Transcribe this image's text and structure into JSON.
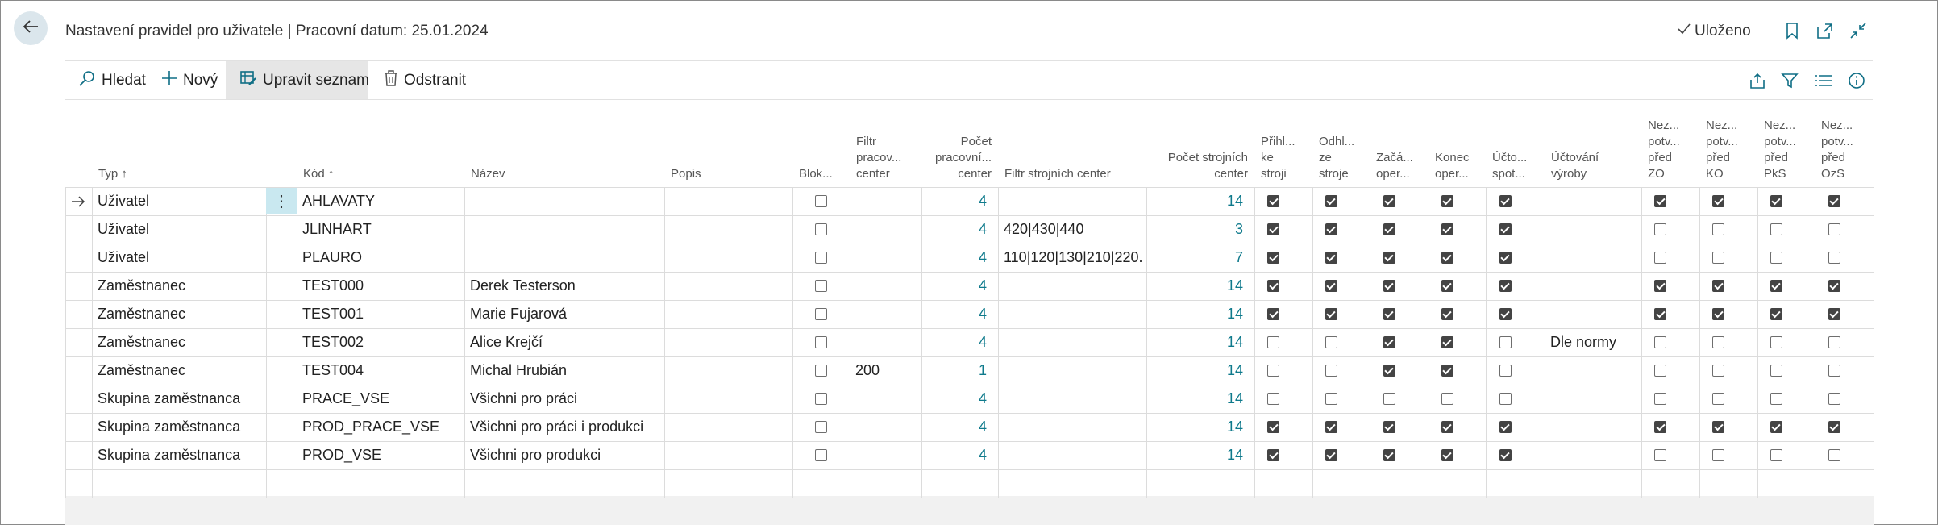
{
  "header": {
    "title": "Nastavení pravidel pro uživatele | Pracovní datum: 25.01.2024",
    "saved_label": "Uloženo"
  },
  "actions": {
    "search": "Hledat",
    "new": "Nový",
    "edit_list": "Upravit seznam",
    "delete": "Odstranit"
  },
  "columns": [
    {
      "key": "typ",
      "label": "Typ ↑"
    },
    {
      "key": "kod",
      "label": "Kód ↑"
    },
    {
      "key": "nazev",
      "label": "Název"
    },
    {
      "key": "popis",
      "label": "Popis"
    },
    {
      "key": "blok",
      "label": "Blok..."
    },
    {
      "key": "filtr_prac",
      "label": "Filtr\npracov...\ncenter"
    },
    {
      "key": "pocet_prac",
      "label": "Počet\npracovní...\ncenter"
    },
    {
      "key": "filtr_stroj",
      "label": "Filtr strojních center"
    },
    {
      "key": "pocet_stroj",
      "label": "Počet strojních\ncenter"
    },
    {
      "key": "prihl",
      "label": "Přihl...\nke\nstroji"
    },
    {
      "key": "odhl",
      "label": "Odhl...\nze\nstroje"
    },
    {
      "key": "zaca",
      "label": "Začá...\noper..."
    },
    {
      "key": "konec",
      "label": "Konec\noper..."
    },
    {
      "key": "ucto",
      "label": "Účto...\nspot..."
    },
    {
      "key": "uctovani",
      "label": "Účtování\nvýroby"
    },
    {
      "key": "nez_zo",
      "label": "Nez...\npotv...\npřed\nZO"
    },
    {
      "key": "nez_ko",
      "label": "Nez...\npotv...\npřed\nKO"
    },
    {
      "key": "nez_pks",
      "label": "Nez...\npotv...\npřed\nPkS"
    },
    {
      "key": "nez_ozs",
      "label": "Nez...\npotv...\npřed\nOzS"
    }
  ],
  "rows": [
    {
      "typ": "Uživatel",
      "kod": "AHLAVATY",
      "nazev": "",
      "popis": "",
      "blok": false,
      "filtr_prac": "",
      "pocet_prac": "4",
      "filtr_stroj": "",
      "pocet_stroj": "14",
      "prihl": true,
      "odhl": true,
      "zaca": true,
      "konec": true,
      "ucto": true,
      "uctovani": "",
      "nez_zo": true,
      "nez_ko": true,
      "nez_pks": true,
      "nez_ozs": true
    },
    {
      "typ": "Uživatel",
      "kod": "JLINHART",
      "nazev": "",
      "popis": "",
      "blok": false,
      "filtr_prac": "",
      "pocet_prac": "4",
      "filtr_stroj": "420|430|440",
      "pocet_stroj": "3",
      "prihl": true,
      "odhl": true,
      "zaca": true,
      "konec": true,
      "ucto": true,
      "uctovani": "",
      "nez_zo": false,
      "nez_ko": false,
      "nez_pks": false,
      "nez_ozs": false
    },
    {
      "typ": "Uživatel",
      "kod": "PLAURO",
      "nazev": "",
      "popis": "",
      "blok": false,
      "filtr_prac": "",
      "pocet_prac": "4",
      "filtr_stroj": "110|120|130|210|220...",
      "pocet_stroj": "7",
      "prihl": true,
      "odhl": true,
      "zaca": true,
      "konec": true,
      "ucto": true,
      "uctovani": "",
      "nez_zo": false,
      "nez_ko": false,
      "nez_pks": false,
      "nez_ozs": false
    },
    {
      "typ": "Zaměstnanec",
      "kod": "TEST000",
      "nazev": "Derek Testerson",
      "popis": "",
      "blok": false,
      "filtr_prac": "",
      "pocet_prac": "4",
      "filtr_stroj": "",
      "pocet_stroj": "14",
      "prihl": true,
      "odhl": true,
      "zaca": true,
      "konec": true,
      "ucto": true,
      "uctovani": "",
      "nez_zo": true,
      "nez_ko": true,
      "nez_pks": true,
      "nez_ozs": true
    },
    {
      "typ": "Zaměstnanec",
      "kod": "TEST001",
      "nazev": "Marie Fujarová",
      "popis": "",
      "blok": false,
      "filtr_prac": "",
      "pocet_prac": "4",
      "filtr_stroj": "",
      "pocet_stroj": "14",
      "prihl": true,
      "odhl": true,
      "zaca": true,
      "konec": true,
      "ucto": true,
      "uctovani": "",
      "nez_zo": true,
      "nez_ko": true,
      "nez_pks": true,
      "nez_ozs": true
    },
    {
      "typ": "Zaměstnanec",
      "kod": "TEST002",
      "nazev": "Alice Krejčí",
      "popis": "",
      "blok": false,
      "filtr_prac": "",
      "pocet_prac": "4",
      "filtr_stroj": "",
      "pocet_stroj": "14",
      "prihl": false,
      "odhl": false,
      "zaca": true,
      "konec": true,
      "ucto": false,
      "uctovani": "Dle normy",
      "nez_zo": false,
      "nez_ko": false,
      "nez_pks": false,
      "nez_ozs": false
    },
    {
      "typ": "Zaměstnanec",
      "kod": "TEST004",
      "nazev": "Michal Hrubián",
      "popis": "",
      "blok": false,
      "filtr_prac": "200",
      "pocet_prac": "1",
      "filtr_stroj": "",
      "pocet_stroj": "14",
      "prihl": false,
      "odhl": false,
      "zaca": true,
      "konec": true,
      "ucto": false,
      "uctovani": "",
      "nez_zo": false,
      "nez_ko": false,
      "nez_pks": false,
      "nez_ozs": false
    },
    {
      "typ": "Skupina zaměstnanca",
      "kod": "PRACE_VSE",
      "nazev": "Všichni pro práci",
      "popis": "",
      "blok": false,
      "filtr_prac": "",
      "pocet_prac": "4",
      "filtr_stroj": "",
      "pocet_stroj": "14",
      "prihl": false,
      "odhl": false,
      "zaca": false,
      "konec": false,
      "ucto": false,
      "uctovani": "",
      "nez_zo": false,
      "nez_ko": false,
      "nez_pks": false,
      "nez_ozs": false
    },
    {
      "typ": "Skupina zaměstnanca",
      "kod": "PROD_PRACE_VSE",
      "nazev": "Všichni pro práci i produkci",
      "popis": "",
      "blok": false,
      "filtr_prac": "",
      "pocet_prac": "4",
      "filtr_stroj": "",
      "pocet_stroj": "14",
      "prihl": true,
      "odhl": true,
      "zaca": true,
      "konec": true,
      "ucto": true,
      "uctovani": "",
      "nez_zo": true,
      "nez_ko": true,
      "nez_pks": true,
      "nez_ozs": true
    },
    {
      "typ": "Skupina zaměstnanca",
      "kod": "PROD_VSE",
      "nazev": "Všichni pro produkci",
      "popis": "",
      "blok": false,
      "filtr_prac": "",
      "pocet_prac": "4",
      "filtr_stroj": "",
      "pocet_stroj": "14",
      "prihl": true,
      "odhl": true,
      "zaca": true,
      "konec": true,
      "ucto": true,
      "uctovani": "",
      "nez_zo": false,
      "nez_ko": false,
      "nez_pks": false,
      "nez_ozs": false
    }
  ],
  "colors": {
    "accent": "#0f7a8c",
    "selection": "#c9e8f0"
  }
}
